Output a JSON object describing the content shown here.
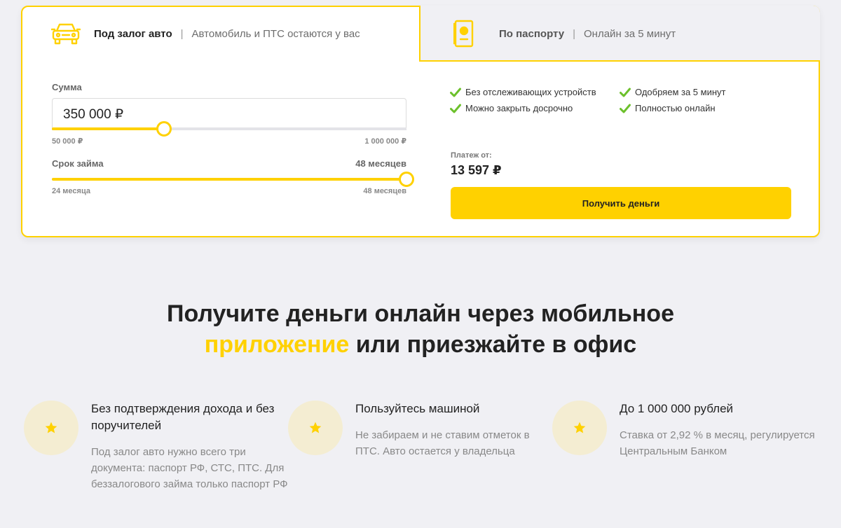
{
  "tabs": {
    "auto": {
      "title": "Под залог авто",
      "subtitle": "Автомобиль и ПТС остаются у вас",
      "icon": "car-icon"
    },
    "passport": {
      "title": "По паспорту",
      "subtitle": "Онлайн за 5 минут",
      "icon": "passport-icon"
    }
  },
  "calculator": {
    "amount_label": "Сумма",
    "amount_value": "350 000 ₽",
    "amount_min": "50 000 ₽",
    "amount_max": "1 000 000 ₽",
    "amount_fraction": 0.316,
    "term_label": "Срок займа",
    "term_value": "48 месяцев",
    "term_min": "24 месяца",
    "term_max": "48 месяцев",
    "term_fraction": 1.0
  },
  "benefits": [
    "Без отслеживающих устройств",
    "Одобряем за 5 минут",
    "Можно закрыть досрочно",
    "Полностью онлайн"
  ],
  "payment": {
    "label": "Платеж от:",
    "value": "13 597 ₽"
  },
  "cta": {
    "label": "Получить деньги"
  },
  "headline": {
    "line1": "Получите деньги онлайн через мобильное",
    "accent": "приложение",
    "rest": " или приезжайте в офис"
  },
  "features": [
    {
      "title": "Без подтверждения дохода и без поручителей",
      "desc": "Под залог авто нужно всего три документа: паспорт РФ, СТС, ПТС. Для беззалогового займа только паспорт РФ",
      "icon": "star-icon"
    },
    {
      "title": "Пользуйтесь машиной",
      "desc": "Не забираем и не ставим отметок в ПТС. Авто остается у владельца",
      "icon": "star-icon"
    },
    {
      "title": "До 1 000 000 рублей",
      "desc": "Ставка от 2,92 % в месяц, регулируется Центральным Банком",
      "icon": "star-icon"
    }
  ],
  "colors": {
    "accent": "#ffd100",
    "check": "#6cc02b",
    "background": "#f0f0f4"
  }
}
